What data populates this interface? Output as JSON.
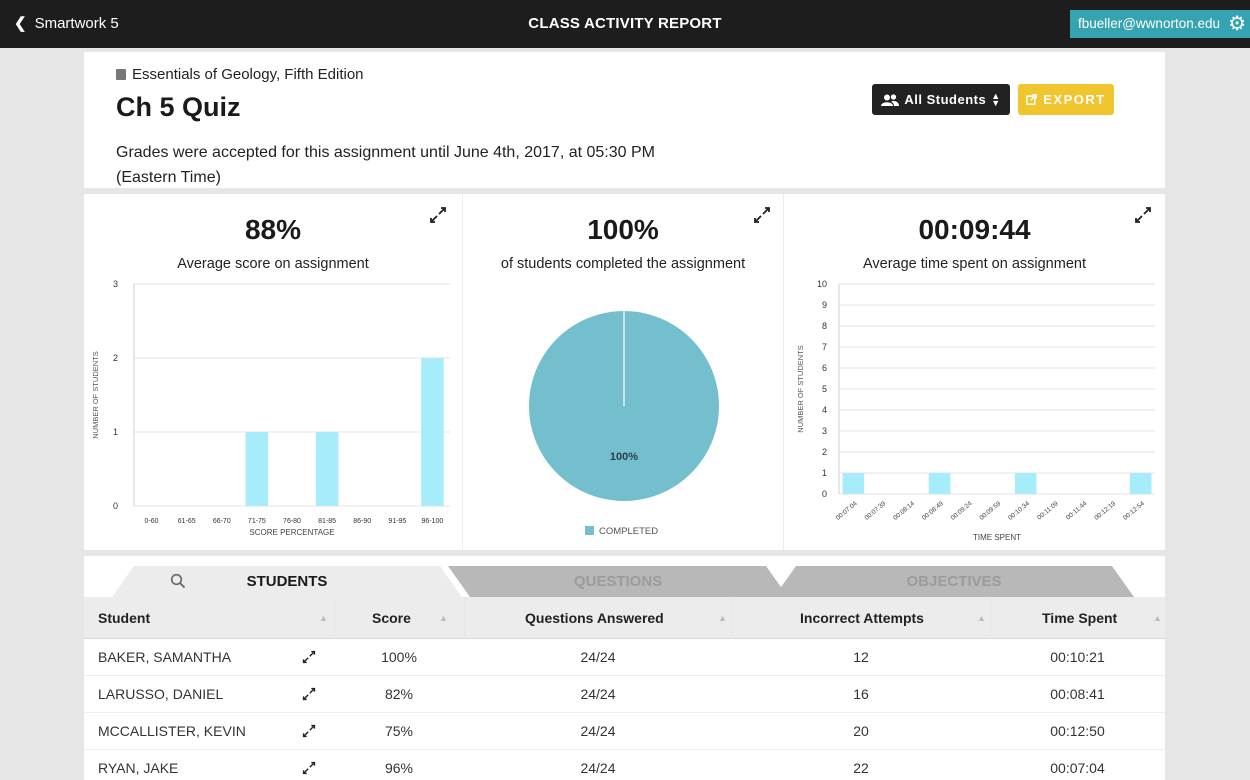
{
  "topbar": {
    "back_label": "Smartwork 5",
    "title": "CLASS ACTIVITY REPORT",
    "user_email": "fbueller@wwnorton.edu"
  },
  "header": {
    "book": "Essentials of Geology, Fifth Edition",
    "title": "Ch 5 Quiz",
    "note": "Grades were accepted for this assignment until June 4th, 2017, at 05:30 PM (Eastern Time)",
    "students_button": "All Students",
    "export_button": "EXPORT"
  },
  "colors": {
    "topbar": "#1d1d1d",
    "user_badge": "#36a3b0",
    "export": "#f0c52e",
    "bar": "#a6ecfa",
    "pie": "#74bfcd"
  },
  "stats": [
    {
      "value": "88%",
      "label": "Average score on assignment"
    },
    {
      "value": "100%",
      "label": "of students completed the assignment"
    },
    {
      "value": "00:09:44",
      "label": "Average time spent on assignment"
    }
  ],
  "chart_data": [
    {
      "type": "bar",
      "title": "Average score on assignment",
      "xlabel": "SCORE PERCENTAGE",
      "ylabel": "NUMBER OF STUDENTS",
      "categories": [
        "0-60",
        "61-65",
        "66-70",
        "71-75",
        "76-80",
        "81-85",
        "86-90",
        "91-95",
        "96-100"
      ],
      "values": [
        0,
        0,
        0,
        1,
        0,
        1,
        0,
        0,
        2
      ],
      "ylim": [
        0,
        3
      ],
      "yticks": [
        "0",
        "1",
        "2",
        "3"
      ],
      "grid": true
    },
    {
      "type": "pie",
      "title": "of students completed the assignment",
      "labels": [
        "COMPLETED"
      ],
      "values": [
        100
      ],
      "slice_label": "100%",
      "legend": "bottom"
    },
    {
      "type": "bar",
      "title": "Average time spent on assignment",
      "xlabel": "TIME SPENT",
      "ylabel": "NUMBER OF STUDENTS",
      "categories": [
        "00:07:04",
        "00:07:39",
        "00:08:14",
        "00:08:49",
        "00:09:24",
        "00:09:59",
        "00:10:34",
        "00:11:09",
        "00:11:44",
        "00:12:19",
        "00:12:54"
      ],
      "values": [
        1,
        0,
        0,
        1,
        0,
        0,
        1,
        0,
        0,
        0,
        1
      ],
      "ylim": [
        0,
        10
      ],
      "yticks": [
        "0",
        "1",
        "2",
        "3",
        "4",
        "5",
        "6",
        "7",
        "8",
        "9",
        "10"
      ],
      "grid": true
    }
  ],
  "tabs": [
    "STUDENTS",
    "QUESTIONS",
    "OBJECTIVES"
  ],
  "table": {
    "columns": [
      "Student",
      "Score",
      "Questions Answered",
      "Incorrect Attempts",
      "Time Spent"
    ],
    "rows": [
      [
        "BAKER, SAMANTHA",
        "100%",
        "24/24",
        "12",
        "00:10:21"
      ],
      [
        "LARUSSO, DANIEL",
        "82%",
        "24/24",
        "16",
        "00:08:41"
      ],
      [
        "MCCALLISTER, KEVIN",
        "75%",
        "24/24",
        "20",
        "00:12:50"
      ],
      [
        "RYAN, JAKE",
        "96%",
        "24/24",
        "22",
        "00:07:04"
      ]
    ]
  }
}
